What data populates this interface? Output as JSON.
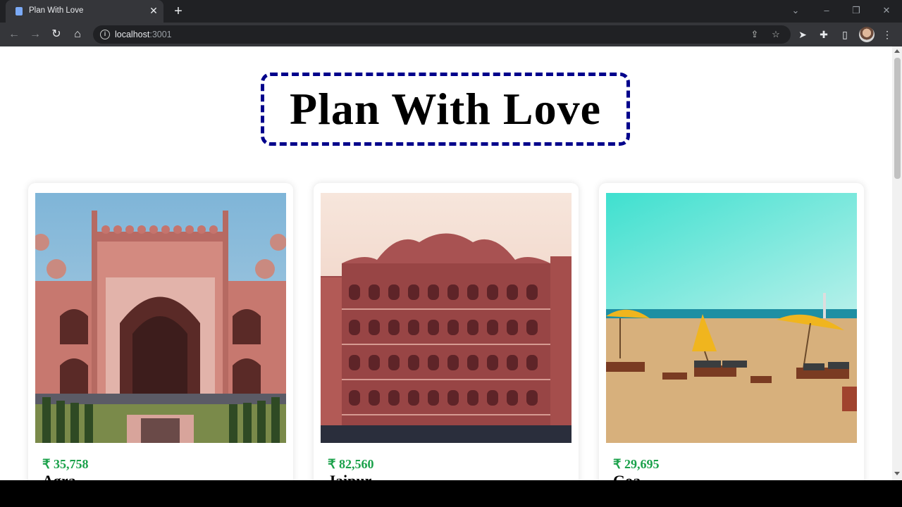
{
  "browser": {
    "tab_title": "Plan With Love",
    "url_host": "localhost",
    "url_port": ":3001"
  },
  "page": {
    "heading": "Plan With Love",
    "cards": [
      {
        "price": "₹ 35,758",
        "city": "Agra"
      },
      {
        "price": "₹ 82,560",
        "city": "Jaipur"
      },
      {
        "price": "₹ 29,695",
        "city": "Goa"
      }
    ]
  },
  "colors": {
    "heading_border": "#00008b",
    "price_text": "#1aa14a",
    "browser_chrome": "#35363a"
  }
}
